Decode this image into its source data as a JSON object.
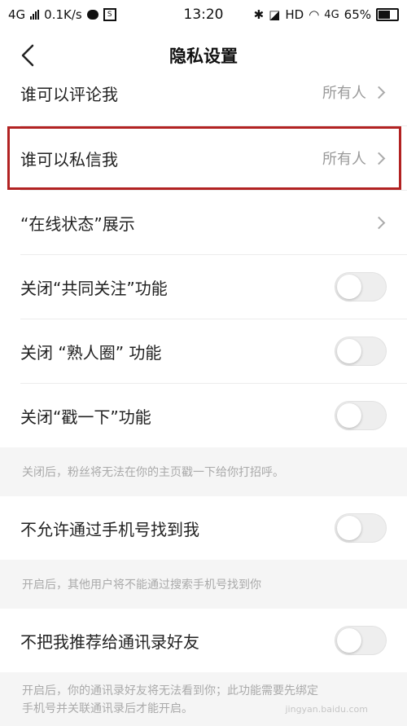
{
  "status_bar": {
    "network_left": "4G",
    "speed": "0.1K/s",
    "time": "13:20",
    "hd": "HD",
    "network_right": "4G",
    "battery": "65%"
  },
  "nav": {
    "title": "隐私设置"
  },
  "rows": [
    {
      "label": "谁可以评论我",
      "value": "所有人"
    },
    {
      "label": "谁可以私信我",
      "value": "所有人"
    },
    {
      "label": "“在线状态”展示",
      "value": ""
    },
    {
      "label": "关闭“共同关注”功能",
      "toggle": false
    },
    {
      "label": "关闭 “熟人圈” 功能",
      "toggle": false
    },
    {
      "label": "关闭“戳一下”功能",
      "toggle": false
    }
  ],
  "hint1": "关闭后，粉丝将无法在你的主页戳一下给你打招呼。",
  "phone_row": {
    "label": "不允许通过手机号找到我",
    "toggle": false
  },
  "hint2": "开启后，其他用户将不能通过搜索手机号找到你",
  "contacts_row": {
    "label": "不把我推荐给通讯录好友",
    "toggle": false
  },
  "hint3_line1": "开启后，你的通讯录好友将无法看到你；此功能需要先绑定",
  "hint3_line2": "手机号并关联通讯录后才能开启。",
  "watermark": "jingyan.baidu.com",
  "colors": {
    "highlight": "#b22222",
    "toggle_off": "#eeeeee",
    "hint_bg": "#f5f5f5"
  }
}
